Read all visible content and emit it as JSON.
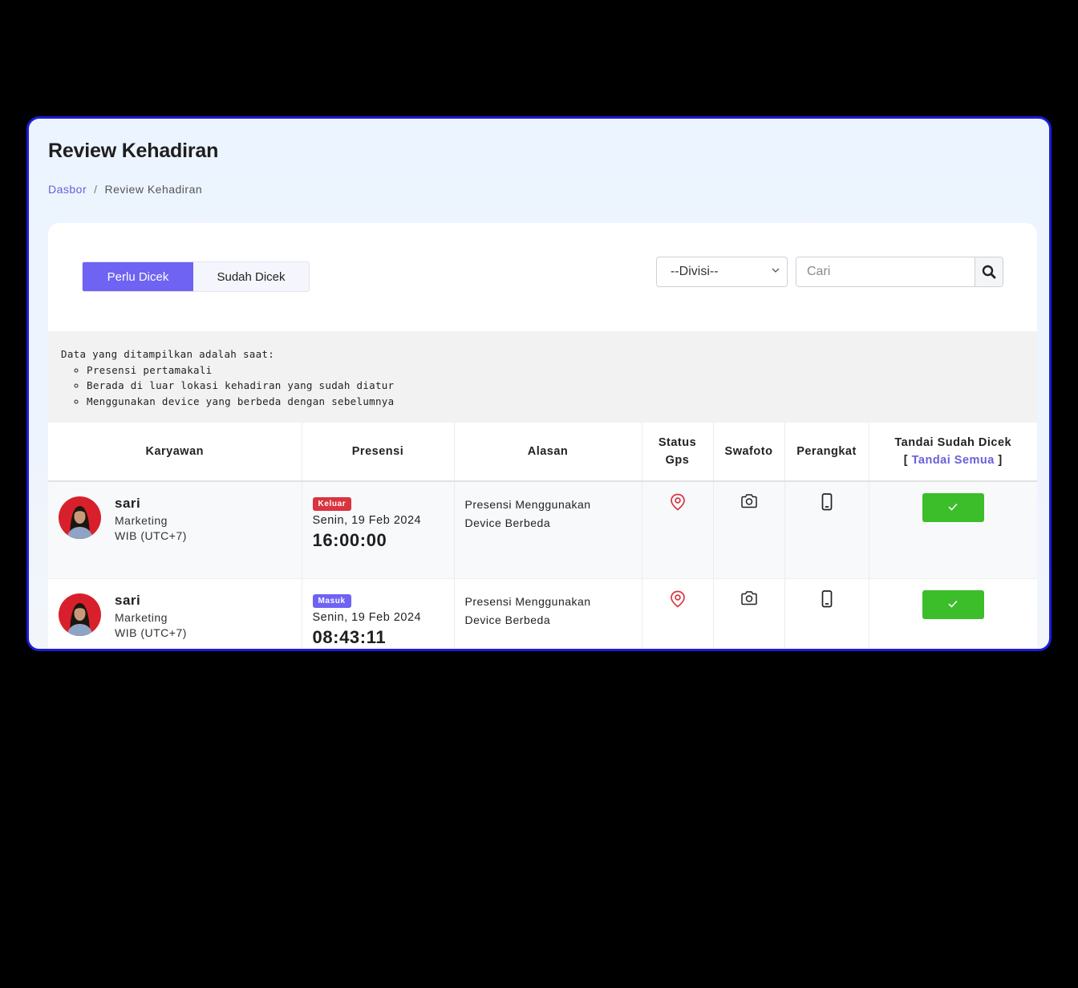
{
  "page": {
    "title": "Review Kehadiran",
    "breadcrumb": {
      "home": "Dasbor",
      "separator": "/",
      "current": "Review Kehadiran"
    }
  },
  "filters": {
    "tabs": [
      {
        "label": "Perlu Dicek",
        "active": true
      },
      {
        "label": "Sudah Dicek",
        "active": false
      }
    ],
    "division_select": {
      "selected": "--Divisi--"
    },
    "search": {
      "placeholder": "Cari",
      "icon": "search-icon"
    }
  },
  "note": {
    "intro": "Data yang ditampilkan adalah saat:",
    "items": [
      "Presensi pertamakali",
      "Berada di luar lokasi kehadiran yang sudah diatur",
      "Menggunakan device yang berbeda dengan sebelumnya"
    ]
  },
  "table": {
    "headers": {
      "employee": "Karyawan",
      "attendance": "Presensi",
      "reason": "Alasan",
      "gps_line1": "Status",
      "gps_line2": "Gps",
      "selfie": "Swafoto",
      "device": "Perangkat",
      "mark_line1": "Tandai Sudah Dicek",
      "mark_open": "[",
      "mark_all": "Tandai Semua",
      "mark_close": "]"
    },
    "rows": [
      {
        "name": "sari",
        "division": "Marketing",
        "timezone": "WIB (UTC+7)",
        "badge": "Keluar",
        "date": "Senin, 19 Feb 2024",
        "time": "16:00:00",
        "reason": "Presensi Menggunakan Device Berbeda"
      },
      {
        "name": "sari",
        "division": "Marketing",
        "timezone": "WIB (UTC+7)",
        "badge": "Masuk",
        "date": "Senin, 19 Feb 2024",
        "time": "08:43:11",
        "reason": "Presensi Menggunakan Device Berbeda"
      }
    ]
  },
  "colors": {
    "accent": "#6e63f2",
    "badge_out": "#d9343f",
    "badge_in": "#6e63f2",
    "check_button": "#3cbd2a",
    "gps_icon": "#d9343f",
    "window_border": "#1c1cd9"
  }
}
